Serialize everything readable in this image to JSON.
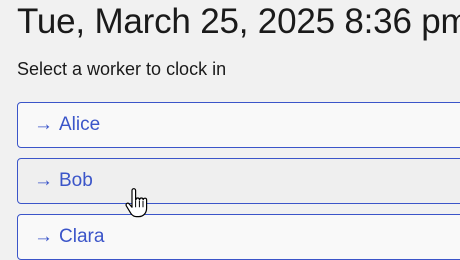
{
  "header": {
    "datetime": "Tue, March 25, 2025 8:36 pm"
  },
  "prompt": "Select a worker to clock in",
  "workers": [
    {
      "arrow": "→",
      "name": "Alice"
    },
    {
      "arrow": "→",
      "name": "Bob"
    },
    {
      "arrow": "→",
      "name": "Clara"
    }
  ],
  "cursor": {
    "icon": "hand-pointer-icon"
  },
  "colors": {
    "accent": "#3b55c9",
    "background": "#f1f1f1",
    "button_bg": "#f9f9f9",
    "button_hover_bg": "#efefef",
    "text": "#1a1a1a"
  }
}
